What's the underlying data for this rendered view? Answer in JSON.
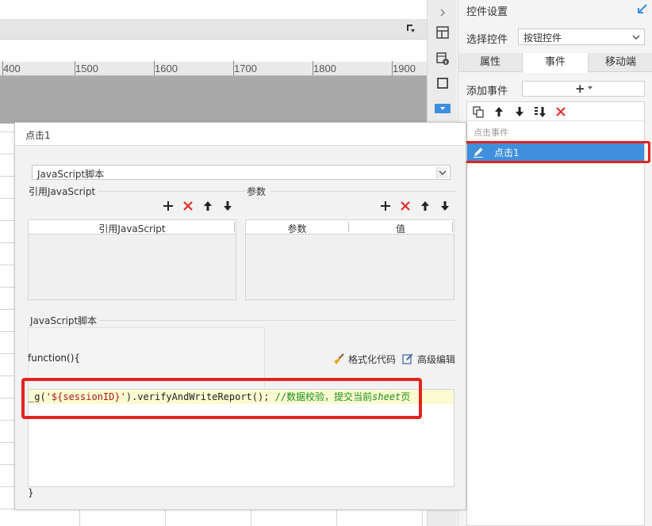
{
  "ruler": {
    "ticks": [
      "400",
      "1500",
      "1600",
      "1700",
      "1800",
      "1900"
    ]
  },
  "right_panel": {
    "title": "控件设置",
    "select_label": "选择控件",
    "select_value": "按钮控件",
    "tabs": [
      "属性",
      "事件",
      "移动端"
    ],
    "active_tab": "事件",
    "add_event_label": "添加事件",
    "event_group": "点击事件",
    "event_item": "点击1"
  },
  "dialog": {
    "title": "点击1",
    "type_value": "JavaScript脚本",
    "ref_js_label": "引用JavaScript",
    "params_label": "参数",
    "ref_table_header": "引用JavaScript",
    "param_table_headers": [
      "参数",
      "值"
    ],
    "script_label": "JavaScript脚本",
    "function_sig": "function(){",
    "format_code": "格式化代码",
    "advanced_edit": "高级编辑",
    "code": {
      "part1": "_g(",
      "part2": "'${sessionID}'",
      "part3": ").verifyAndWriteReport(); ",
      "part4": "//数据校验，提交当前",
      "part5": "sheet",
      "part6": "页"
    },
    "function_close": "}"
  },
  "colors": {
    "highlight": "#e3231e",
    "selected_item": "#3f8fdc",
    "code_line_bg": "#fbfbd2"
  }
}
